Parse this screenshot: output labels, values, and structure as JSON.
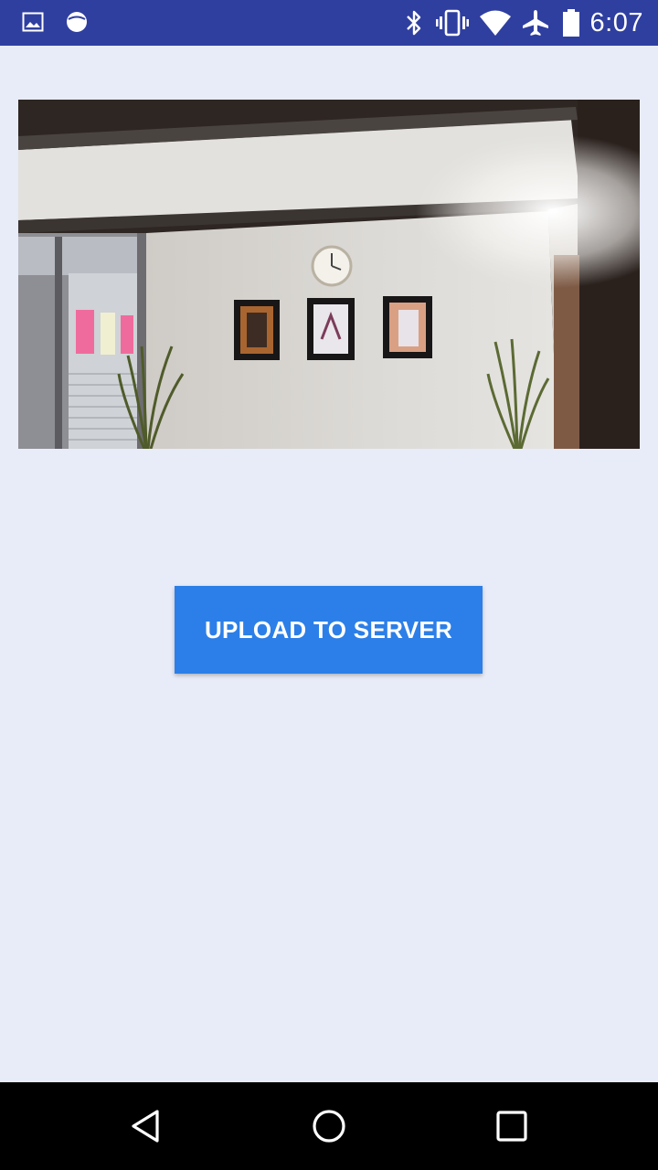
{
  "status_bar": {
    "time": "6:07",
    "left_icons": [
      "image-notification-icon",
      "circle-notification-icon"
    ],
    "right_icons": [
      "bluetooth-icon",
      "vibrate-icon",
      "wifi-icon",
      "airplane-mode-icon",
      "battery-icon"
    ],
    "background": "#2f3fa0"
  },
  "main": {
    "background": "#e8ebf8",
    "upload_button_label": "UPLOAD TO SERVER",
    "button_color": "#2c7fe8"
  },
  "nav_bar": {
    "icons": [
      "back-icon",
      "home-icon",
      "recents-icon"
    ]
  }
}
